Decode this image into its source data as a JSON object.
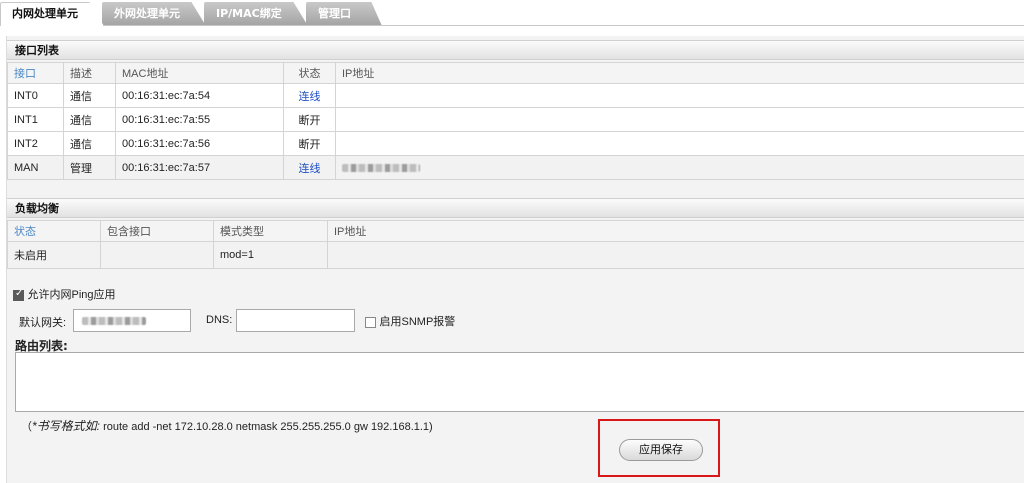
{
  "tabs": [
    {
      "label": "内网处理单元",
      "active": true
    },
    {
      "label": "外网处理单元",
      "active": false
    },
    {
      "label": "IP/MAC绑定",
      "active": false
    },
    {
      "label": "管理口",
      "active": false
    }
  ],
  "interfaces": {
    "title": "接口列表",
    "headers": [
      "接口",
      "描述",
      "MAC地址",
      "状态",
      "IP地址"
    ],
    "rows": [
      {
        "name": "INT0",
        "desc": "通信",
        "mac": "00:16:31:ec:7a:54",
        "status": "连线",
        "ip": ""
      },
      {
        "name": "INT1",
        "desc": "通信",
        "mac": "00:16:31:ec:7a:55",
        "status": "断开",
        "ip": ""
      },
      {
        "name": "INT2",
        "desc": "通信",
        "mac": "00:16:31:ec:7a:56",
        "status": "断开",
        "ip": ""
      },
      {
        "name": "MAN",
        "desc": "管理",
        "mac": "00:16:31:ec:7a:57",
        "status": "连线",
        "ip": "(redacted)"
      }
    ]
  },
  "load_balance": {
    "title": "负载均衡",
    "headers": [
      "状态",
      "包含接口",
      "模式类型",
      "IP地址"
    ],
    "row": {
      "status": "未启用",
      "interfaces": "",
      "mode": "mod=1",
      "ip": ""
    }
  },
  "settings": {
    "allow_ping_label": "允许内网Ping应用",
    "allow_ping_checked": true,
    "gateway_label": "默认网关:",
    "gateway_value": "(redacted)",
    "dns_label": "DNS:",
    "dns_value": "",
    "snmp_label": "启用SNMP报警",
    "snmp_checked": false,
    "route_label": "路由列表:",
    "route_value": "",
    "hint_open": "（",
    "hint_prefix": "*书写格式如:",
    "hint_example": "route add -net 172.10.28.0 netmask 255.255.255.0 gw 192.168.1.1)",
    "save_label": "应用保存"
  },
  "colors": {
    "highlight": "#d81818",
    "link": "#1d4fc4",
    "header_text": "#4a87c5"
  }
}
